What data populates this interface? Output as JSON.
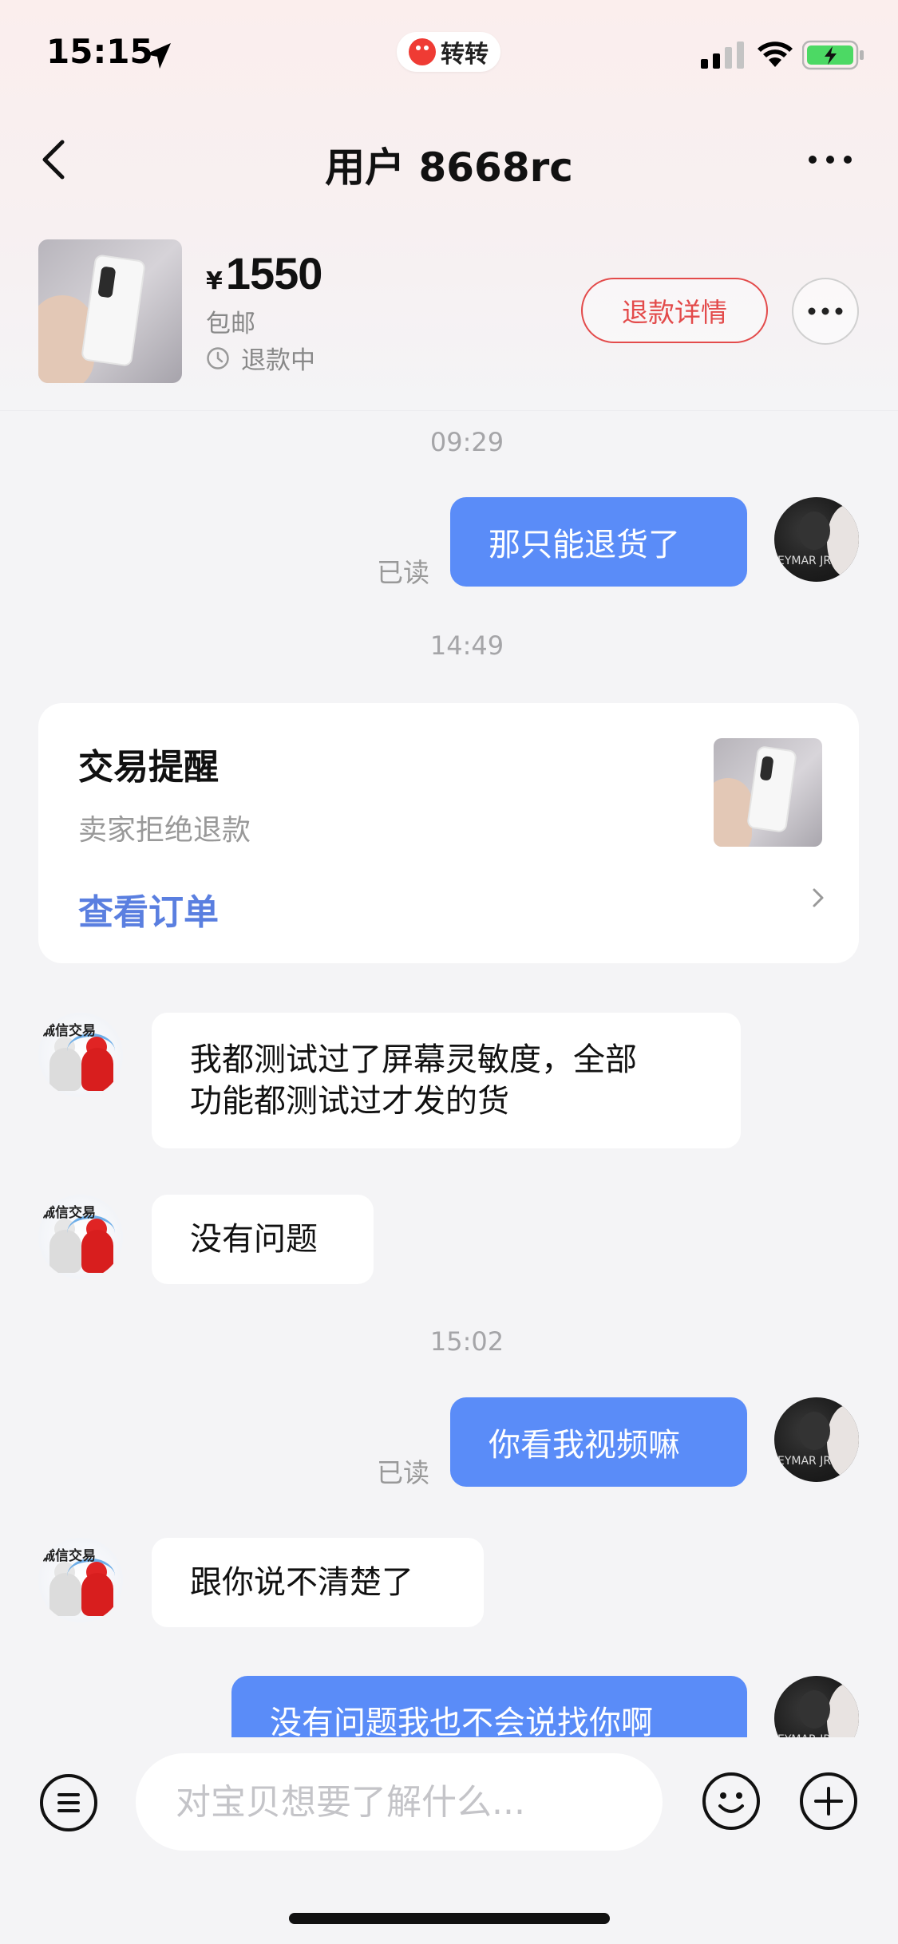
{
  "status_bar": {
    "time": "15:15",
    "app_name": "转转"
  },
  "nav": {
    "title": "用户 8668rc"
  },
  "product": {
    "price_symbol": "¥",
    "price": "1550",
    "shipping": "包邮",
    "status": "退款中",
    "refund_button": "退款详情"
  },
  "chat": {
    "time_1": "09:29",
    "msg_1": "那只能退货了",
    "read_1": "已读",
    "time_2": "14:49",
    "card": {
      "title": "交易提醒",
      "subtitle": "卖家拒绝退款",
      "link": "查看订单"
    },
    "msg_2_line1": "我都测试过了屏幕灵敏度，全部",
    "msg_2_line2": "功能都测试过才发的货",
    "msg_3": "没有问题",
    "time_3": "15:02",
    "msg_4": "你看我视频嘛",
    "read_4": "已读",
    "msg_5": "跟你说不清楚了",
    "msg_6": "没有问题我也不会说找你啊",
    "avatar_self_text": "EYMAR JR",
    "avatar_other_text": "诚信交易"
  },
  "input": {
    "placeholder": "对宝贝想要了解什么..."
  }
}
